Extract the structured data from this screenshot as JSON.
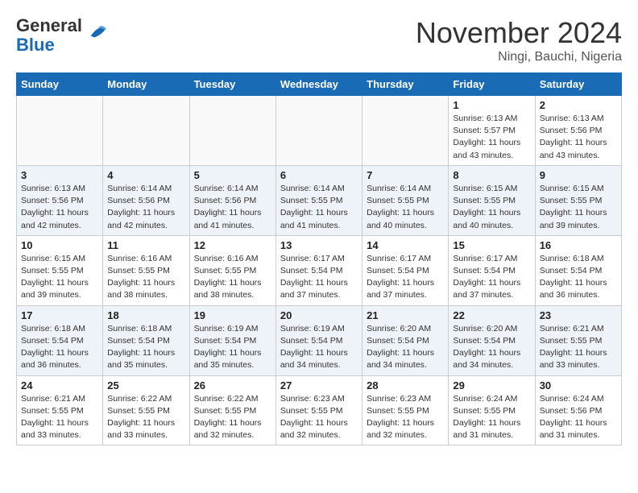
{
  "header": {
    "logo_line1": "General",
    "logo_line2": "Blue",
    "month": "November 2024",
    "location": "Ningi, Bauchi, Nigeria"
  },
  "weekdays": [
    "Sunday",
    "Monday",
    "Tuesday",
    "Wednesday",
    "Thursday",
    "Friday",
    "Saturday"
  ],
  "weeks": [
    [
      {
        "day": "",
        "info": ""
      },
      {
        "day": "",
        "info": ""
      },
      {
        "day": "",
        "info": ""
      },
      {
        "day": "",
        "info": ""
      },
      {
        "day": "",
        "info": ""
      },
      {
        "day": "1",
        "info": "Sunrise: 6:13 AM\nSunset: 5:57 PM\nDaylight: 11 hours\nand 43 minutes."
      },
      {
        "day": "2",
        "info": "Sunrise: 6:13 AM\nSunset: 5:56 PM\nDaylight: 11 hours\nand 43 minutes."
      }
    ],
    [
      {
        "day": "3",
        "info": "Sunrise: 6:13 AM\nSunset: 5:56 PM\nDaylight: 11 hours\nand 42 minutes."
      },
      {
        "day": "4",
        "info": "Sunrise: 6:14 AM\nSunset: 5:56 PM\nDaylight: 11 hours\nand 42 minutes."
      },
      {
        "day": "5",
        "info": "Sunrise: 6:14 AM\nSunset: 5:56 PM\nDaylight: 11 hours\nand 41 minutes."
      },
      {
        "day": "6",
        "info": "Sunrise: 6:14 AM\nSunset: 5:55 PM\nDaylight: 11 hours\nand 41 minutes."
      },
      {
        "day": "7",
        "info": "Sunrise: 6:14 AM\nSunset: 5:55 PM\nDaylight: 11 hours\nand 40 minutes."
      },
      {
        "day": "8",
        "info": "Sunrise: 6:15 AM\nSunset: 5:55 PM\nDaylight: 11 hours\nand 40 minutes."
      },
      {
        "day": "9",
        "info": "Sunrise: 6:15 AM\nSunset: 5:55 PM\nDaylight: 11 hours\nand 39 minutes."
      }
    ],
    [
      {
        "day": "10",
        "info": "Sunrise: 6:15 AM\nSunset: 5:55 PM\nDaylight: 11 hours\nand 39 minutes."
      },
      {
        "day": "11",
        "info": "Sunrise: 6:16 AM\nSunset: 5:55 PM\nDaylight: 11 hours\nand 38 minutes."
      },
      {
        "day": "12",
        "info": "Sunrise: 6:16 AM\nSunset: 5:55 PM\nDaylight: 11 hours\nand 38 minutes."
      },
      {
        "day": "13",
        "info": "Sunrise: 6:17 AM\nSunset: 5:54 PM\nDaylight: 11 hours\nand 37 minutes."
      },
      {
        "day": "14",
        "info": "Sunrise: 6:17 AM\nSunset: 5:54 PM\nDaylight: 11 hours\nand 37 minutes."
      },
      {
        "day": "15",
        "info": "Sunrise: 6:17 AM\nSunset: 5:54 PM\nDaylight: 11 hours\nand 37 minutes."
      },
      {
        "day": "16",
        "info": "Sunrise: 6:18 AM\nSunset: 5:54 PM\nDaylight: 11 hours\nand 36 minutes."
      }
    ],
    [
      {
        "day": "17",
        "info": "Sunrise: 6:18 AM\nSunset: 5:54 PM\nDaylight: 11 hours\nand 36 minutes."
      },
      {
        "day": "18",
        "info": "Sunrise: 6:18 AM\nSunset: 5:54 PM\nDaylight: 11 hours\nand 35 minutes."
      },
      {
        "day": "19",
        "info": "Sunrise: 6:19 AM\nSunset: 5:54 PM\nDaylight: 11 hours\nand 35 minutes."
      },
      {
        "day": "20",
        "info": "Sunrise: 6:19 AM\nSunset: 5:54 PM\nDaylight: 11 hours\nand 34 minutes."
      },
      {
        "day": "21",
        "info": "Sunrise: 6:20 AM\nSunset: 5:54 PM\nDaylight: 11 hours\nand 34 minutes."
      },
      {
        "day": "22",
        "info": "Sunrise: 6:20 AM\nSunset: 5:54 PM\nDaylight: 11 hours\nand 34 minutes."
      },
      {
        "day": "23",
        "info": "Sunrise: 6:21 AM\nSunset: 5:55 PM\nDaylight: 11 hours\nand 33 minutes."
      }
    ],
    [
      {
        "day": "24",
        "info": "Sunrise: 6:21 AM\nSunset: 5:55 PM\nDaylight: 11 hours\nand 33 minutes."
      },
      {
        "day": "25",
        "info": "Sunrise: 6:22 AM\nSunset: 5:55 PM\nDaylight: 11 hours\nand 33 minutes."
      },
      {
        "day": "26",
        "info": "Sunrise: 6:22 AM\nSunset: 5:55 PM\nDaylight: 11 hours\nand 32 minutes."
      },
      {
        "day": "27",
        "info": "Sunrise: 6:23 AM\nSunset: 5:55 PM\nDaylight: 11 hours\nand 32 minutes."
      },
      {
        "day": "28",
        "info": "Sunrise: 6:23 AM\nSunset: 5:55 PM\nDaylight: 11 hours\nand 32 minutes."
      },
      {
        "day": "29",
        "info": "Sunrise: 6:24 AM\nSunset: 5:55 PM\nDaylight: 11 hours\nand 31 minutes."
      },
      {
        "day": "30",
        "info": "Sunrise: 6:24 AM\nSunset: 5:56 PM\nDaylight: 11 hours\nand 31 minutes."
      }
    ]
  ]
}
